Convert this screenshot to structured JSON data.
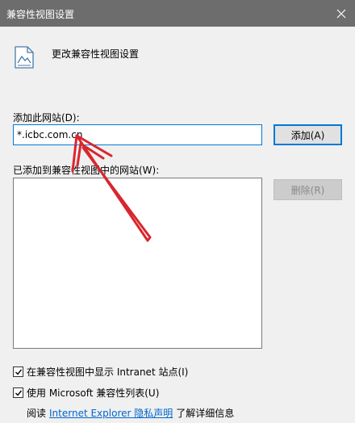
{
  "window": {
    "title": "兼容性视图设置"
  },
  "header": {
    "text": "更改兼容性视图设置",
    "icon": "page-settings-icon"
  },
  "add_section": {
    "label": "添加此网站(D):",
    "input_value": "*.icbc.com.cn",
    "add_button": "添加(A)"
  },
  "list_section": {
    "label": "已添加到兼容性视图中的网站(W):",
    "remove_button": "删除(R)",
    "items": []
  },
  "options": {
    "intranet": {
      "label": "在兼容性视图中显示 Intranet 站点(I)",
      "checked": true
    },
    "ms_list": {
      "label": "使用 Microsoft 兼容性列表(U)",
      "checked": true
    }
  },
  "footer": {
    "prefix": "阅读",
    "link": "Internet Explorer 隐私声明",
    "suffix": "了解详细信息"
  },
  "colors": {
    "titlebar": "#6d6d6d",
    "accent": "#0078d7",
    "annotation_arrow": "#d9262e"
  }
}
